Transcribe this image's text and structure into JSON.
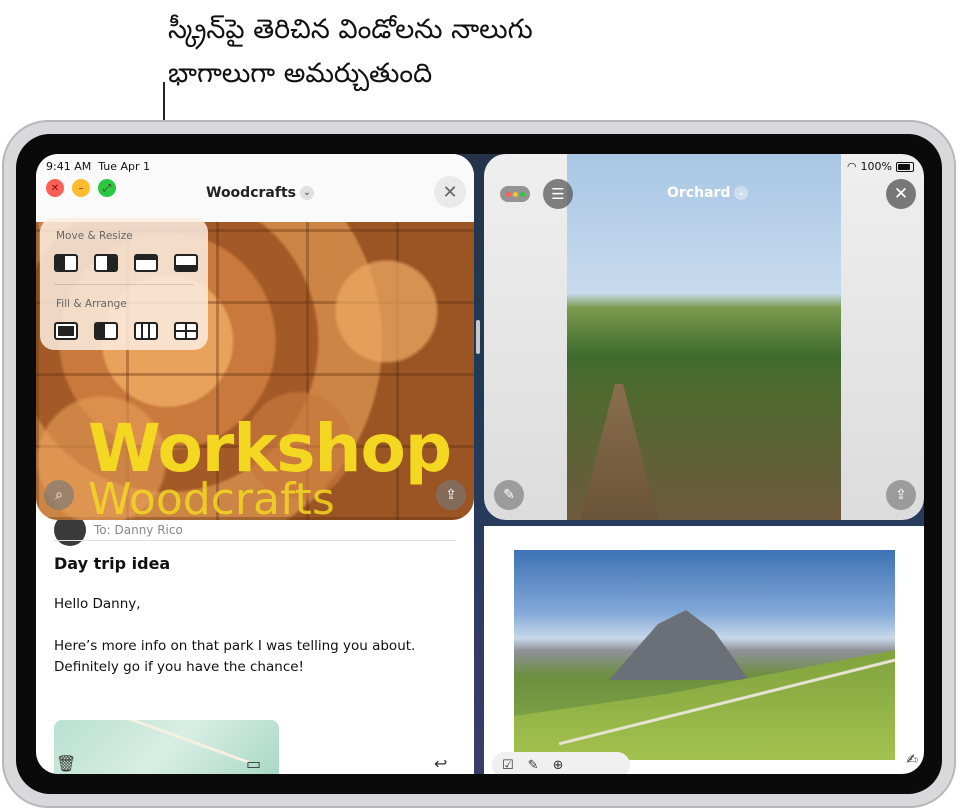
{
  "callout": {
    "line1": "స్క్రీన్‌పై తెరిచిన విండోలను నాలుగు",
    "line2": "భాగాలుగా అమర్చుతుంది"
  },
  "status": {
    "time": "9:41 AM",
    "date": "Tue Apr 1",
    "battery": "100%"
  },
  "woodcrafts": {
    "title": "Woodcrafts",
    "hero_line1": "Workshop",
    "hero_line2": "Woodcrafts"
  },
  "popover": {
    "section1": "Move & Resize",
    "section2": "Fill & Arrange"
  },
  "orchard": {
    "title": "Orchard"
  },
  "mail": {
    "to": "To: Danny Rico",
    "subject": "Day trip idea",
    "greeting": "Hello Danny,",
    "body": "Here’s more info on that park I was telling you about. Definitely go if you have the chance!"
  },
  "colors": {
    "yellow_text": "#f4d721",
    "close_red": "#ff5f57",
    "minimize_yellow": "#febc2e",
    "zoom_green": "#28c840"
  }
}
